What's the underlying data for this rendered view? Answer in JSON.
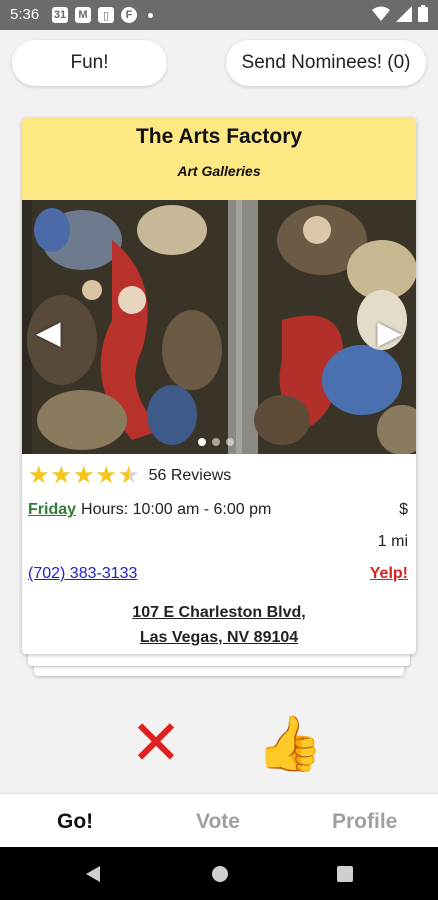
{
  "status_bar": {
    "time": "5:36",
    "notification_icons": [
      "calendar-icon",
      "gmail-icon",
      "sim-icon",
      "app-icon"
    ],
    "right_icons": [
      "wifi-icon",
      "signal-icon",
      "battery-icon"
    ]
  },
  "top_bar": {
    "fun_label": "Fun!",
    "send_label": "Send Nominees! (0)"
  },
  "card": {
    "name": "The Arts Factory",
    "category": "Art Galleries",
    "photo_page": 1,
    "photo_pages": 3,
    "rating": 4.5,
    "rating_max": 5,
    "stars_glyphs": "★★★★★",
    "reviews": "56 Reviews",
    "hours_day": "Friday",
    "hours_text": "Hours: 10:00 am - 6:00 pm",
    "price": "$",
    "distance": "1 mi",
    "phone": "(702) 383-3133",
    "yelp": "Yelp!",
    "address_line1": "107 E Charleston Blvd,",
    "address_line2": "Las Vegas, NV 89104",
    "prev_arrow": "◀",
    "next_arrow": "▶"
  },
  "actions": {
    "reject_glyph": "✕",
    "approve_glyph": "👍"
  },
  "bottom_nav": {
    "items": [
      {
        "label": "Go!",
        "active": true
      },
      {
        "label": "Vote",
        "active": false
      },
      {
        "label": "Profile",
        "active": false
      }
    ]
  },
  "colors": {
    "header_yellow": "#fee884",
    "star_gold": "#f5c518",
    "day_green": "#2e7d32",
    "phone_blue": "#2222cc",
    "yelp_red": "#d32323",
    "reject_red": "#e02020"
  }
}
